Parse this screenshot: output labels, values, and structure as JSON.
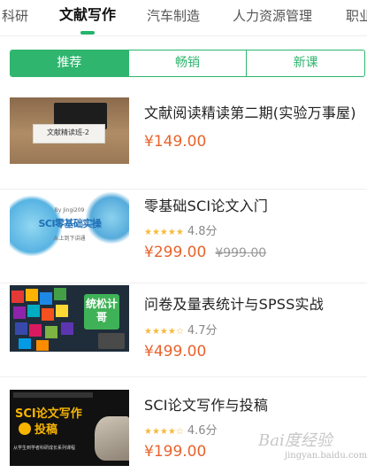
{
  "tabs": [
    {
      "label": "科研",
      "active": false
    },
    {
      "label": "文献写作",
      "active": true
    },
    {
      "label": "汽车制造",
      "active": false
    },
    {
      "label": "人力资源管理",
      "active": false
    },
    {
      "label": "职业",
      "active": false
    }
  ],
  "segments": [
    {
      "label": "推荐",
      "active": true
    },
    {
      "label": "畅销",
      "active": false
    },
    {
      "label": "新课",
      "active": false
    }
  ],
  "courses": [
    {
      "title": "文献阅读精读第二期(实验万事屋)",
      "thumb_text": "文献精读班-2",
      "price": "¥149.00"
    },
    {
      "title": "零基础SCI论文入门",
      "thumb_text": "SCI零基础实操",
      "thumb_sub": "By Jingi209",
      "thumb_sub2": "从上到下讲通",
      "rating": "4.8分",
      "rating_value": 4.8,
      "price": "¥299.00",
      "old_price": "¥999.00"
    },
    {
      "title": "问卷及量表统计与SPSS实战",
      "thumb_text": "统松计哥",
      "rating": "4.7分",
      "rating_value": 4.7,
      "price": "¥499.00"
    },
    {
      "title": "SCI论文写作与投稿",
      "thumb_text": "SCI论文写作",
      "thumb_text2": "投稿",
      "thumb_text3": "从学生到学者科研成长系列课程",
      "rating": "4.6分",
      "rating_value": 4.6,
      "price": "¥199.00"
    }
  ],
  "watermark": "Bai度经验",
  "watermark_sub": "jingyan.baidu.com",
  "colors": {
    "accent": "#2fb56e",
    "price": "#e8632c",
    "star": "#f6b93b"
  }
}
